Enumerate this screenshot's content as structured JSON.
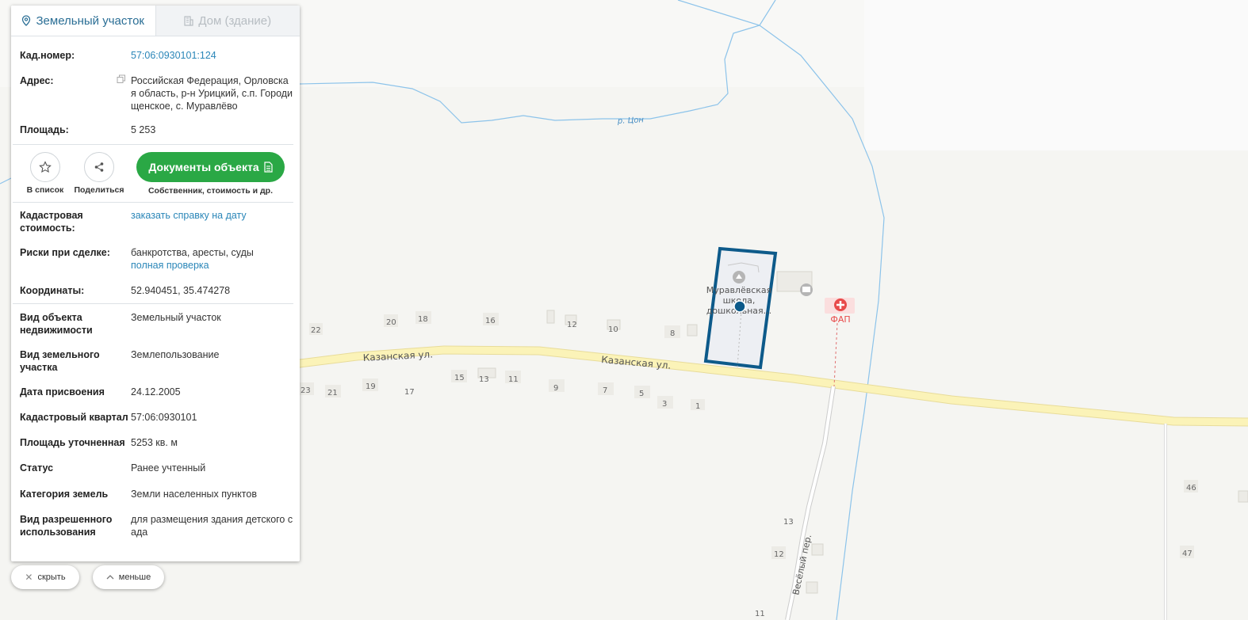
{
  "map": {
    "river_label": "р. Цон",
    "street_main_1": "Казанская ул.",
    "street_main_2": "Казанская ул.",
    "street_side": "Весёлый пер.",
    "poi_school": [
      "Муравлёвская",
      "школа,",
      "дошкольная..."
    ],
    "poi_fap": "ФАП",
    "house_numbers": [
      "22",
      "20",
      "18",
      "16",
      "12",
      "10",
      "8",
      "23",
      "21",
      "19",
      "17",
      "15",
      "13",
      "11",
      "9",
      "7",
      "5",
      "3",
      "1",
      "46",
      "47",
      "13",
      "12",
      "11"
    ]
  },
  "panel": {
    "tabs": [
      {
        "label": "Земельный участок",
        "icon": "location-pin-icon"
      },
      {
        "label": "Дом (здание)",
        "icon": "building-icon"
      }
    ],
    "kad_number": {
      "key": "Кад.номер:",
      "value": "57:06:0930101:124"
    },
    "address": {
      "key": "Адрес:",
      "value": "Российская Федерация, Орловская область, р-н Урицкий, с.п. Городищенское, с. Муравлёво"
    },
    "area": {
      "key": "Площадь:",
      "value": "5 253"
    },
    "actions": {
      "favorite": "В список",
      "share": "Поделиться",
      "documents": "Документы объекта",
      "documents_sub": "Собственник, стоимость и др."
    },
    "cad_cost": {
      "key": "Кадастровая стоимость:",
      "value": "заказать справку на дату"
    },
    "risks": {
      "key": "Риски при сделке:",
      "value": "банкротства, аресты, суды",
      "link": "полная проверка"
    },
    "coords": {
      "key": "Координаты:",
      "value": "52.940451, 35.474278"
    },
    "details": [
      {
        "key": "Вид объекта недвижимости",
        "value": "Земельный участок"
      },
      {
        "key": "Вид земельного участка",
        "value": "Землепользование"
      },
      {
        "key": "Дата присвоения",
        "value": "24.12.2005"
      },
      {
        "key": "Кадастровый квартал",
        "value": "57:06:0930101"
      },
      {
        "key": "Площадь уточненная",
        "value": "5253 кв. м"
      },
      {
        "key": "Статус",
        "value": "Ранее учтенный"
      },
      {
        "key": "Категория земель",
        "value": "Земли населенных пунктов"
      },
      {
        "key": "Вид разрешенного использования",
        "value": "для размещения здания детского сада"
      }
    ]
  },
  "controls": {
    "hide": "скрыть",
    "less": "меньше"
  },
  "colors": {
    "link": "#2a86b8",
    "green": "#2aa845",
    "parcel": "#0d5a8a",
    "road": "#fbf3b8",
    "river": "#8cc3ea"
  }
}
